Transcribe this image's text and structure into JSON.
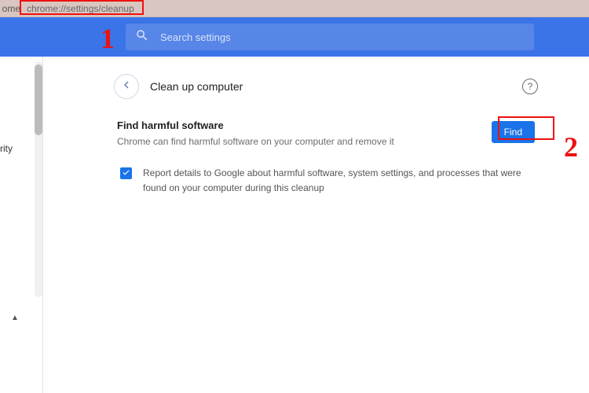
{
  "address": {
    "home": "ome",
    "url": "chrome://settings/cleanup"
  },
  "search": {
    "placeholder": "Search settings"
  },
  "sidebar": {
    "label": "rity"
  },
  "page": {
    "title": "Clean up computer",
    "find": {
      "title": "Find harmful software",
      "desc": "Chrome can find harmful software on your computer and remove it",
      "button": "Find"
    },
    "report": {
      "checked": true,
      "label": "Report details to Google about harmful software, system settings, and processes that were found on your computer during this cleanup"
    }
  },
  "annotations": {
    "step1": "1",
    "step2": "2"
  }
}
